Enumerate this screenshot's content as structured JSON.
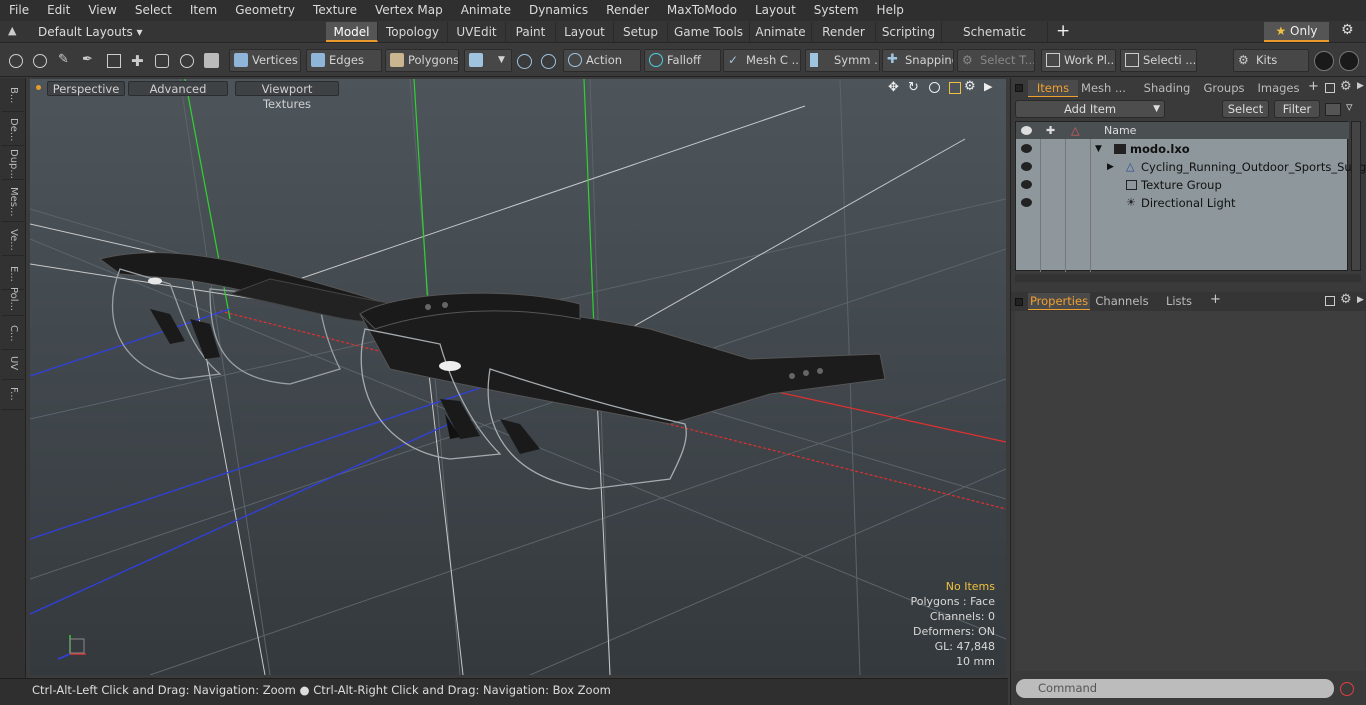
{
  "menu": [
    "File",
    "Edit",
    "View",
    "Select",
    "Item",
    "Geometry",
    "Texture",
    "Vertex Map",
    "Animate",
    "Dynamics",
    "Render",
    "MaxToModo",
    "Layout",
    "System",
    "Help"
  ],
  "layout_selector": "Default Layouts",
  "tabs": [
    "Model",
    "Topology",
    "UVEdit",
    "Paint",
    "Layout",
    "Setup",
    "Game Tools",
    "Animate",
    "Render",
    "Scripting",
    "Schematic Fusion"
  ],
  "active_tab": "Model",
  "only_label": "Only",
  "toolbar": {
    "vertices": "Vertices",
    "edges": "Edges",
    "polygons": "Polygons",
    "action": "Action",
    "falloff": "Falloff",
    "mesh": "Mesh C ...",
    "symm": "Symm ...",
    "snapping": "Snapping",
    "select_t": "Select T...",
    "work_pl": "Work Pl...",
    "selecti": "Selecti ...",
    "kits": "Kits"
  },
  "left_tabs": [
    "B...",
    "De...",
    "Dup...",
    "Mes...",
    "Ve...",
    "E...",
    "Pol...",
    "C...",
    "UV",
    "F..."
  ],
  "viewport": {
    "tabs": [
      "Perspective",
      "Advanced",
      "Viewport Textures"
    ],
    "info": {
      "no_items": "No Items",
      "polygons": "Polygons : Face",
      "channels": "Channels: 0",
      "deformers": "Deformers: ON",
      "gl": "GL: 47,848",
      "scale": "10 mm"
    }
  },
  "status_text": "Ctrl-Alt-Left Click and Drag: Navigation: Zoom ● Ctrl-Alt-Right Click and Drag: Navigation: Box Zoom",
  "right_panel": {
    "top_tabs": [
      "Items",
      "Mesh ...",
      "Shading",
      "Groups",
      "Images"
    ],
    "add_item": "Add Item",
    "select_btn": "Select",
    "filter_btn": "Filter",
    "name_col": "Name",
    "items": [
      {
        "label": "modo.lxo",
        "bold": true
      },
      {
        "label": "Cycling_Running_Outdoor_Sports_Sung...",
        "bold": false
      },
      {
        "label": "Texture Group",
        "bold": false
      },
      {
        "label": "Directional Light",
        "bold": false
      }
    ],
    "bottom_tabs": [
      "Properties",
      "Channels",
      "Lists"
    ],
    "command_placeholder": "Command"
  },
  "colors": {
    "accent": "#e89a2c",
    "x_axis": "#e03030",
    "y_axis": "#30d030",
    "z_axis": "#3040e0"
  }
}
